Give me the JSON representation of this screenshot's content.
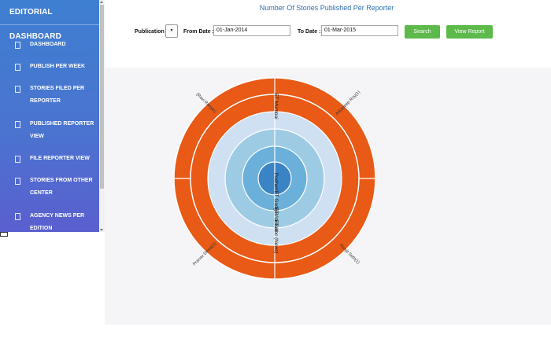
{
  "sidebar": {
    "title": "EDITORIAL DASHBOARD",
    "items": [
      {
        "lines": [
          "DASHBOARD"
        ]
      },
      {
        "lines": [
          "PUBLISH PER WEEK"
        ]
      },
      {
        "lines": [
          "STORIES FILED PER",
          "REPORTER"
        ]
      },
      {
        "lines": [
          "PUBLISHED REPORTER",
          "VIEW"
        ]
      },
      {
        "lines": [
          "FILE REPORTER VIEW"
        ]
      },
      {
        "lines": [
          "STORIES FROM OTHER",
          "CENTER"
        ]
      },
      {
        "lines": [
          "AGENCY NEWS PER",
          "EDITION"
        ]
      }
    ]
  },
  "header": {
    "title": "Number Of Stories Published Per Reporter",
    "publication_label": "Publication",
    "publication_value": "",
    "dropdown_glyph": "▼",
    "from_label": "From Date :",
    "from_value": "01-Jan-2014",
    "to_label": "To Date :",
    "to_value": "01-Mar-2015",
    "search_label": "Search",
    "view_report_label": "View Report"
  },
  "chart_data": {
    "type": "sunburst",
    "levels": [
      {
        "name": "Pudhari",
        "color": "#3a84c6"
      },
      {
        "name": "ET Gadget",
        "color": "#6ab0da"
      },
      {
        "name": "ET Abroad",
        "color": "#9ecbe4"
      },
      {
        "name": "ET Abc (News)",
        "color": "#cfe0f3"
      },
      {
        "name": "ET Mumbai",
        "color": "#cfe0f3"
      }
    ],
    "inner_labels": [
      "Pudhari",
      "ET Gadget",
      "ET Abroad",
      "ET Abc (News)",
      "ET Mumbai"
    ],
    "outer_color": "#e85a16",
    "outer_segments": [
      {
        "label": "(Ravi Ranjan)"
      },
      {
        "label": "Arkadeep Roy(1)"
      },
      {
        "label": "Pranav Desai(1)"
      },
      {
        "label": "Ranjit Seth(1)"
      }
    ]
  }
}
